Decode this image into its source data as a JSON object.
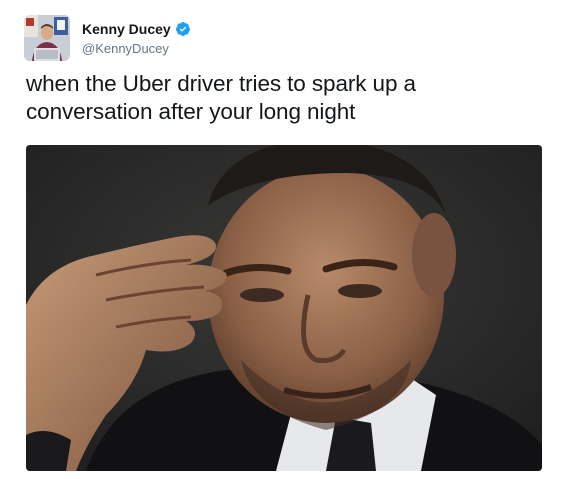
{
  "user": {
    "display_name": "Kenny Ducey",
    "handle": "@KennyDucey",
    "verified": true
  },
  "tweet": {
    "text": "when the Uber driver tries to spark up a conversation after your long night"
  },
  "media": {
    "type": "photo"
  },
  "icons": {
    "verified": "verified-badge-icon"
  },
  "colors": {
    "verified_blue": "#1da1f2",
    "handle_gray": "#657786",
    "text": "#14171a"
  }
}
